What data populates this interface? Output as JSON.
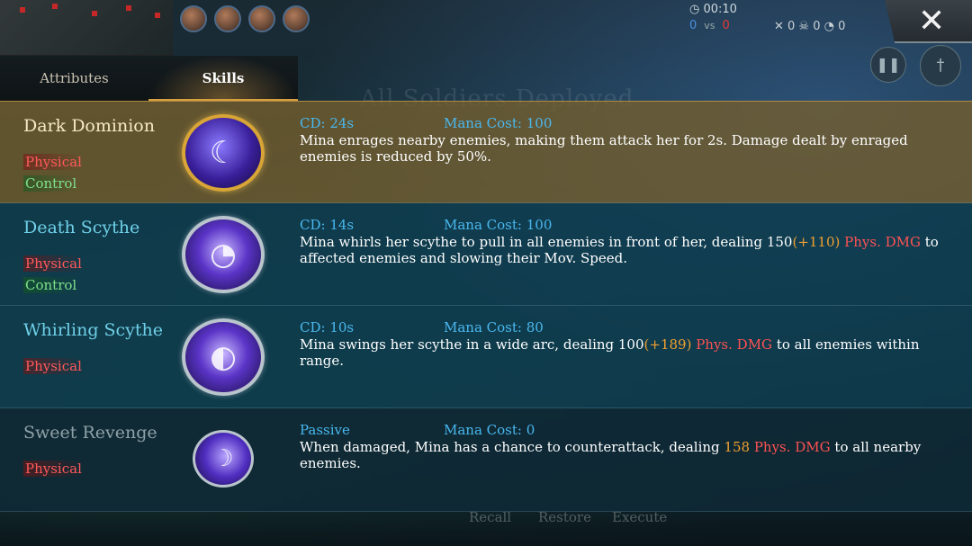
{
  "hud": {
    "timer": "00:10",
    "score_blue": "0",
    "score_vs": "vs",
    "score_red": "0",
    "stats": "✕ 0   ☠ 0   ◔ 0",
    "close_glyph": "✕",
    "pause_glyph": "❚❚",
    "item_glyph": "†"
  },
  "background": {
    "ghost_text": "All Soldiers Deployed",
    "bottom_buttons": [
      "Recall",
      "Restore",
      "Execute"
    ]
  },
  "tabs": [
    {
      "label": "Attributes",
      "active": false
    },
    {
      "label": "Skills",
      "active": true
    }
  ],
  "skills": [
    {
      "name": "Dark Dominion",
      "tags": [
        "Physical",
        "Control"
      ],
      "cd": "CD: 24s",
      "mana": "Mana Cost: 100",
      "desc": [
        {
          "text": "Mina enrages nearby enemies, making them attack her for 2s. Damage dealt by enraged enemies is reduced by 50%.",
          "style": "plain"
        }
      ],
      "icon": "dark-dominion-icon"
    },
    {
      "name": "Death Scythe",
      "tags": [
        "Physical",
        "Control"
      ],
      "cd": "CD: 14s",
      "mana": "Mana Cost: 100",
      "desc": [
        {
          "text": "Mina whirls her scythe to pull in all enemies in front of her, dealing 150",
          "style": "plain"
        },
        {
          "text": "(+110) ",
          "style": "orange"
        },
        {
          "text": "Phys. DMG",
          "style": "red"
        },
        {
          "text": " to affected enemies and slowing their Mov. Speed.",
          "style": "plain"
        }
      ],
      "icon": "death-scythe-icon"
    },
    {
      "name": "Whirling Scythe",
      "tags": [
        "Physical"
      ],
      "cd": "CD: 10s",
      "mana": "Mana Cost: 80",
      "desc": [
        {
          "text": "Mina swings her scythe in a wide arc, dealing 100",
          "style": "plain"
        },
        {
          "text": "(+189) ",
          "style": "orange"
        },
        {
          "text": "Phys. DMG",
          "style": "red"
        },
        {
          "text": " to all enemies within range.",
          "style": "plain"
        }
      ],
      "icon": "whirling-scythe-icon"
    },
    {
      "name": "Sweet Revenge",
      "tags": [
        "Physical"
      ],
      "cd": "Passive",
      "mana": "Mana Cost: 0",
      "desc": [
        {
          "text": "When damaged, Mina has a chance to counterattack, dealing ",
          "style": "plain"
        },
        {
          "text": "158 ",
          "style": "orange"
        },
        {
          "text": "Phys. DMG",
          "style": "red"
        },
        {
          "text": " to all nearby enemies.",
          "style": "plain"
        }
      ],
      "icon": "sweet-revenge-icon"
    }
  ],
  "colors": {
    "accent_gold": "#d9a040",
    "cost_blue": "#49b8ef",
    "physical_red": "#ff5a5a",
    "control_green": "#7ee08a",
    "bonus_orange": "#f0a030"
  }
}
